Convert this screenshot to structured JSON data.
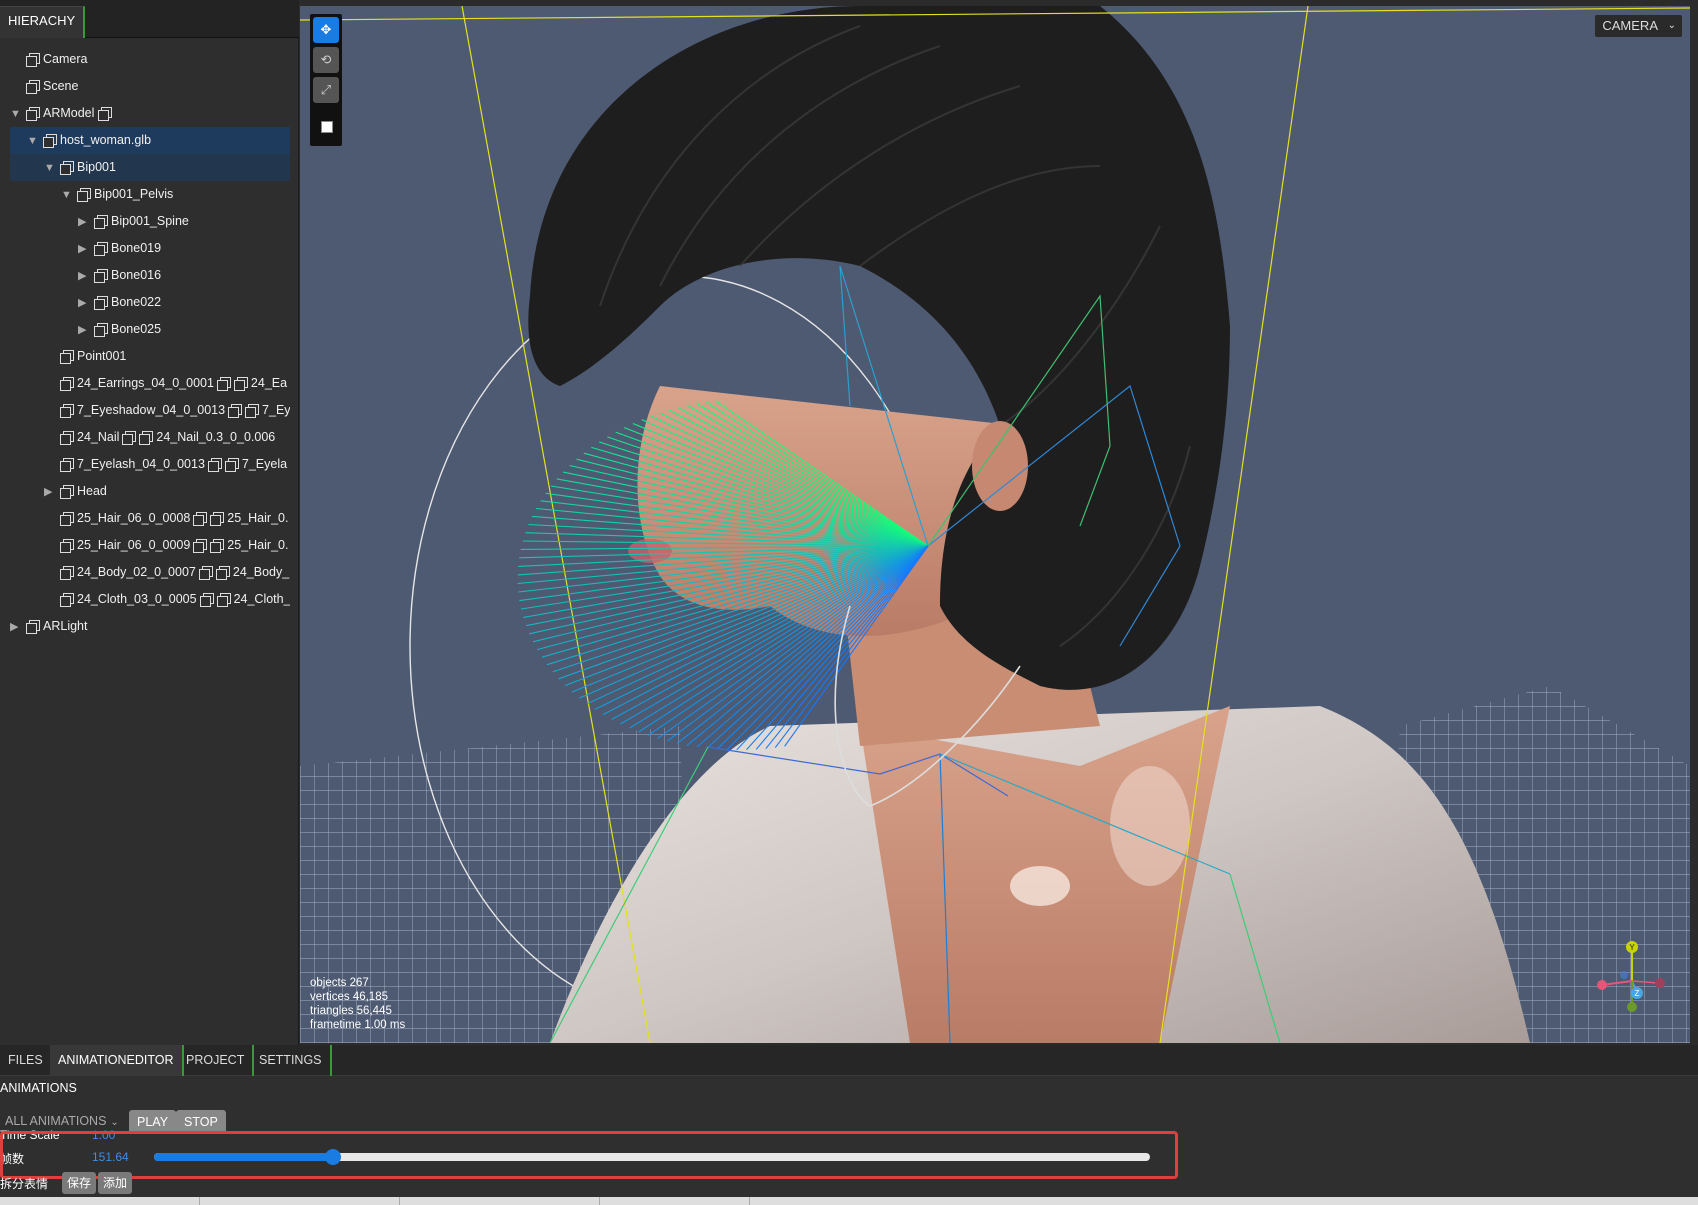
{
  "hierarchy": {
    "tab_label": "HIERACHY",
    "items": [
      {
        "label": "Camera",
        "indent": 0,
        "arrow": "",
        "extra": ""
      },
      {
        "label": "Scene",
        "indent": 0,
        "arrow": "",
        "extra": ""
      },
      {
        "label": "ARModel",
        "indent": 0,
        "arrow": "down",
        "extra": ""
      },
      {
        "label": "host_woman.glb",
        "indent": 1,
        "arrow": "down",
        "extra": ""
      },
      {
        "label": "Bip001",
        "indent": 2,
        "arrow": "down",
        "extra": ""
      },
      {
        "label": "Bip001_Pelvis",
        "indent": 3,
        "arrow": "down",
        "extra": ""
      },
      {
        "label": "Bip001_Spine",
        "indent": 4,
        "arrow": "right",
        "extra": ""
      },
      {
        "label": "Bone019",
        "indent": 4,
        "arrow": "right",
        "extra": ""
      },
      {
        "label": "Bone016",
        "indent": 4,
        "arrow": "right",
        "extra": ""
      },
      {
        "label": "Bone022",
        "indent": 4,
        "arrow": "right",
        "extra": ""
      },
      {
        "label": "Bone025",
        "indent": 4,
        "arrow": "right",
        "extra": ""
      },
      {
        "label": "Point001",
        "indent": 2,
        "arrow": "",
        "extra": ""
      },
      {
        "label": "24_Earrings_04_0_0001",
        "indent": 2,
        "arrow": "",
        "extra": "24_Ea"
      },
      {
        "label": "7_Eyeshadow_04_0_0013",
        "indent": 2,
        "arrow": "",
        "extra": "7_Ey"
      },
      {
        "label": "24_Nail",
        "indent": 2,
        "arrow": "",
        "extra": "24_Nail_0.3_0_0.006"
      },
      {
        "label": "7_Eyelash_04_0_0013",
        "indent": 2,
        "arrow": "",
        "extra": "7_Eyela"
      },
      {
        "label": "Head",
        "indent": 2,
        "arrow": "right",
        "extra": ""
      },
      {
        "label": "25_Hair_06_0_0008",
        "indent": 2,
        "arrow": "",
        "extra": "25_Hair_0."
      },
      {
        "label": "25_Hair_06_0_0009",
        "indent": 2,
        "arrow": "",
        "extra": "25_Hair_0."
      },
      {
        "label": "24_Body_02_0_0007",
        "indent": 2,
        "arrow": "",
        "extra": "24_Body_"
      },
      {
        "label": "24_Cloth_03_0_0005",
        "indent": 2,
        "arrow": "",
        "extra": "24_Cloth_"
      },
      {
        "label": "ARLight",
        "indent": 0,
        "arrow": "right",
        "extra": ""
      }
    ]
  },
  "viewport": {
    "camera_label": "CAMERA",
    "stats": {
      "objects": "objects  267",
      "vertices": "vertices  46,185",
      "triangles": "triangles  56,445",
      "frametime": "frametime  1.00 ms"
    },
    "gizmo": {
      "y": "Y",
      "z": "Z"
    }
  },
  "bottom": {
    "tabs": [
      "FILES",
      "ANIMATIONEDITOR",
      "PROJECT",
      "SETTINGS"
    ],
    "active_tab": "ANIMATIONEDITOR",
    "section_title": "ANIMATIONS",
    "animation_select": "ALL ANIMATIONS",
    "play_label": "PLAY",
    "stop_label": "STOP",
    "time_scale_label": "Time Scale",
    "time_scale_value": "1.00",
    "frame_label": "帧数",
    "frame_value": "151.64",
    "frame_fraction": 0.18,
    "split_label": "拆分表情",
    "save_label": "保存",
    "add_label": "添加"
  }
}
